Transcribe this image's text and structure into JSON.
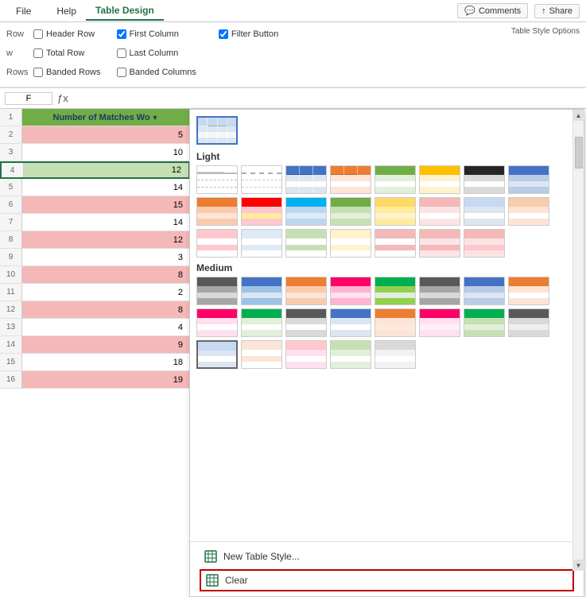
{
  "ribbon": {
    "tabs": [
      "File",
      "Help",
      "Table Design"
    ],
    "active_tab": "Table Design",
    "comment_btn": "Comments",
    "share_btn": "Share"
  },
  "options": {
    "header_row": {
      "label": "Header Row",
      "checked": false,
      "prefix": "Row"
    },
    "first_column": {
      "label": "First Column",
      "checked": true,
      "prefix": "Row"
    },
    "filter_button": {
      "label": "Filter Button",
      "checked": true
    },
    "total_row": {
      "label": "Total Row",
      "checked": false,
      "prefix": "w"
    },
    "last_column": {
      "label": "Last Column",
      "checked": false
    },
    "banded_rows": {
      "label": "Banded Rows",
      "checked": false,
      "prefix": "Rows"
    },
    "banded_columns": {
      "label": "Banded Columns",
      "checked": false
    },
    "group_label": "Table Style Options"
  },
  "formula_bar": {
    "name": "F",
    "value": ""
  },
  "spreadsheet": {
    "header": "Number of Matches Wo",
    "rows": [
      {
        "num": 2,
        "value": "5",
        "style": "pink"
      },
      {
        "num": 3,
        "value": "10",
        "style": "white"
      },
      {
        "num": 4,
        "value": "12",
        "style": "selected"
      },
      {
        "num": 5,
        "value": "14",
        "style": "white"
      },
      {
        "num": 6,
        "value": "15",
        "style": "pink"
      },
      {
        "num": 7,
        "value": "14",
        "style": "white"
      },
      {
        "num": 8,
        "value": "12",
        "style": "pink"
      },
      {
        "num": 9,
        "value": "3",
        "style": "white"
      },
      {
        "num": 10,
        "value": "8",
        "style": "pink"
      },
      {
        "num": 11,
        "value": "2",
        "style": "white"
      },
      {
        "num": 12,
        "value": "8",
        "style": "pink"
      },
      {
        "num": 13,
        "value": "4",
        "style": "white"
      },
      {
        "num": 14,
        "value": "9",
        "style": "pink"
      },
      {
        "num": 15,
        "value": "18",
        "style": "white"
      },
      {
        "num": 16,
        "value": "19",
        "style": "pink"
      }
    ]
  },
  "dropdown": {
    "sections": [
      {
        "id": "current",
        "styles": [
          {
            "id": "current-blue",
            "header_color": "#c6d9f1",
            "row1_color": "#dce6f1",
            "row2_color": "#f2f7fc",
            "border_color": "#4472c4",
            "selected": true
          }
        ]
      },
      {
        "id": "light",
        "label": "Light",
        "styles": [
          {
            "id": "l1",
            "header_color": "#e0e0e0",
            "row1_color": "#f5f5f5",
            "row2_color": "#fff",
            "border_color": "#bbb"
          },
          {
            "id": "l2",
            "header_color": "#e0e0e0",
            "row1_color": "#fff",
            "row2_color": "#e8e8e8",
            "border_color": "#aaa",
            "dashed": true
          },
          {
            "id": "l3",
            "header_color": "#4472c4",
            "row1_color": "#dce6f1",
            "row2_color": "#fff",
            "border_color": "#4472c4"
          },
          {
            "id": "l4",
            "header_color": "#ed7d31",
            "row1_color": "#fce4d6",
            "row2_color": "#fff",
            "border_color": "#ed7d31"
          },
          {
            "id": "l5",
            "header_color": "#a9d18e",
            "row1_color": "#e2efda",
            "row2_color": "#fff",
            "border_color": "#70ad47"
          },
          {
            "id": "l6",
            "header_color": "#ffc000",
            "row1_color": "#fff2cc",
            "row2_color": "#fff",
            "border_color": "#ffc000"
          },
          {
            "id": "l7",
            "header_color": "#333",
            "row1_color": "#e0e0e0",
            "row2_color": "#fff",
            "border_color": "#333"
          },
          {
            "id": "l8",
            "header_color": "#4472c4",
            "row1_color": "#b8cce4",
            "row2_color": "#dce6f1",
            "border_color": "#4472c4"
          },
          {
            "id": "l9",
            "header_color": "#ed7d31",
            "row1_color": "#f8cbad",
            "row2_color": "#fce4d6",
            "border_color": "#ed7d31"
          },
          {
            "id": "l10",
            "header_color": "#ff0000",
            "row1_color": "#ffc7ce",
            "row2_color": "#ffeb9c",
            "border_color": "#ff0000"
          },
          {
            "id": "l11",
            "header_color": "#00b0f0",
            "row1_color": "#ddebf7",
            "row2_color": "#bdd7ee",
            "border_color": "#00b0f0"
          },
          {
            "id": "l12",
            "header_color": "#a9d18e",
            "row1_color": "#c6e0b4",
            "row2_color": "#e2efda",
            "border_color": "#70ad47"
          },
          {
            "id": "l13",
            "header_color": "#ffd966",
            "row1_color": "#ffeb9c",
            "row2_color": "#fff2cc",
            "border_color": "#ffc000"
          },
          {
            "id": "l14",
            "header_color": "#f4b8b8",
            "row1_color": "#fce4e4",
            "row2_color": "#fff",
            "border_color": "#f44336"
          },
          {
            "id": "l15",
            "header_color": "#c6d9f1",
            "row1_color": "#dce6f1",
            "row2_color": "#fff",
            "border_color": "#9bc2e6"
          },
          {
            "id": "l16",
            "header_color": "#f8cbad",
            "row1_color": "#fce4d6",
            "row2_color": "#fff",
            "border_color": "#f4b184"
          },
          {
            "id": "l17",
            "header_color": "#ffc7ce",
            "row1_color": "#fff",
            "row2_color": "#ffc7ce",
            "border_color": "#ff9999"
          },
          {
            "id": "l18",
            "header_color": "#ddebf7",
            "row1_color": "#fff",
            "row2_color": "#ddebf7",
            "border_color": "#bdd7ee"
          },
          {
            "id": "l19",
            "header_color": "#c6e0b4",
            "row1_color": "#fff",
            "row2_color": "#c6e0b4",
            "border_color": "#a9d18e"
          },
          {
            "id": "l20",
            "header_color": "#fff2cc",
            "row1_color": "#fff",
            "row2_color": "#fff2cc",
            "border_color": "#ffd966"
          },
          {
            "id": "l21",
            "header_color": "#f4b8b8",
            "row1_color": "#fff",
            "row2_color": "#f4b8b8",
            "border_color": "#f87171"
          },
          {
            "id": "l22",
            "header_color": "#f4b8b8",
            "row1_color": "#fce4e4",
            "row2_color": "#fff",
            "border_color": "#f87171"
          },
          {
            "id": "l23",
            "header_color": "#f4b8b8",
            "row1_color": "#fce4e4",
            "row2_color": "#ffc7ce",
            "border_color": "#f44336"
          }
        ]
      },
      {
        "id": "medium",
        "label": "Medium",
        "styles": [
          {
            "id": "m1",
            "header_color": "#595959",
            "row1_color": "#a6a6a6",
            "row2_color": "#d9d9d9",
            "border_color": "#333"
          },
          {
            "id": "m2",
            "header_color": "#4472c4",
            "row1_color": "#9dc3e6",
            "row2_color": "#dce6f1",
            "border_color": "#4472c4"
          },
          {
            "id": "m3",
            "header_color": "#ed7d31",
            "row1_color": "#f8cbad",
            "row2_color": "#fce4d6",
            "border_color": "#ed7d31"
          },
          {
            "id": "m4",
            "header_color": "#ff0066",
            "row1_color": "#ffb3d1",
            "row2_color": "#ffe0ee",
            "border_color": "#ff0066"
          },
          {
            "id": "m5",
            "header_color": "#00b050",
            "row1_color": "#92d050",
            "row2_color": "#e2efda",
            "border_color": "#00b050"
          },
          {
            "id": "m6",
            "header_color": "#595959",
            "row1_color": "#a6a6a6",
            "row2_color": "#d9d9d9",
            "border_color": "#555"
          },
          {
            "id": "m7",
            "header_color": "#4472c4",
            "row1_color": "#b8cce4",
            "row2_color": "#dce6f1",
            "border_color": "#4472c4"
          },
          {
            "id": "m8",
            "header_color": "#ed7d31",
            "row1_color": "#fce4d6",
            "row2_color": "#fff",
            "border_color": "#ed7d31"
          },
          {
            "id": "m9",
            "header_color": "#ff0066",
            "row1_color": "#ffe0ee",
            "row2_color": "#fff",
            "border_color": "#ff0066"
          },
          {
            "id": "m10",
            "header_color": "#00b050",
            "row1_color": "#e2efda",
            "row2_color": "#fff",
            "border_color": "#00b050"
          },
          {
            "id": "m11",
            "header_color": "#595959",
            "row1_color": "#d9d9d9",
            "row2_color": "#fff",
            "border_color": "#555"
          },
          {
            "id": "m12",
            "header_color": "#4472c4",
            "row1_color": "#dce6f1",
            "row2_color": "#fff",
            "border_color": "#4472c4"
          },
          {
            "id": "m13",
            "header_color": "#ed7d31",
            "row1_color": "#fce4d6",
            "row2_color": "#fce9dc",
            "border_color": "#ed7d31"
          },
          {
            "id": "m14",
            "header_color": "#ff0066",
            "row1_color": "#ffe0ee",
            "row2_color": "#fff0f5",
            "border_color": "#ff0066"
          },
          {
            "id": "m15",
            "header_color": "#00b050",
            "row1_color": "#c6e0b4",
            "row2_color": "#e2efda",
            "border_color": "#00b050"
          },
          {
            "id": "m16",
            "header_color": "#595959",
            "row1_color": "#d9d9d9",
            "row2_color": "#efefef",
            "border_color": "#555"
          },
          {
            "id": "m17",
            "header_color": "#c6d9f1",
            "row1_color": "#dce6f1",
            "row2_color": "#fff",
            "border_color": "#9bc2e6",
            "selected": true
          },
          {
            "id": "m18",
            "header_color": "#fce4d6",
            "row1_color": "#fff",
            "row2_color": "#fce4d6",
            "border_color": "#f4b184"
          },
          {
            "id": "m19",
            "header_color": "#ffc7ce",
            "row1_color": "#ffe0ee",
            "row2_color": "#fff",
            "border_color": "#ff9999"
          },
          {
            "id": "m20",
            "header_color": "#c6e0b4",
            "row1_color": "#e2efda",
            "row2_color": "#fff",
            "border_color": "#a9d18e"
          },
          {
            "id": "m21",
            "header_color": "#d9d9d9",
            "row1_color": "#f2f2f2",
            "row2_color": "#fff",
            "border_color": "#bbb",
            "selected_box": true
          }
        ]
      }
    ],
    "bottom_items": [
      {
        "id": "new-table-style",
        "label": "New Table Style...",
        "icon": "table-icon"
      },
      {
        "id": "clear",
        "label": "Clear",
        "icon": "clear-icon",
        "highlighted": true
      }
    ]
  }
}
